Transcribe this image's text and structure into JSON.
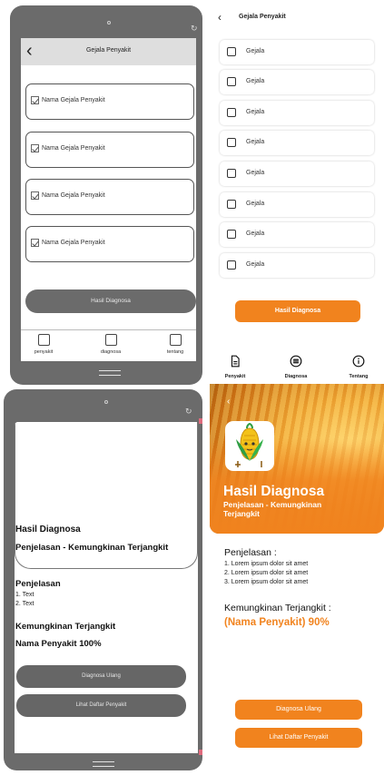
{
  "wireframe_selection": {
    "title": "Gejala Penyakit",
    "items": [
      "Nama Gejala Penyakit",
      "Nama Gejala Penyakit",
      "Nama Gejala Penyakit",
      "Nama Gejala Penyakit"
    ],
    "button_label": "Hasil Diagnosa",
    "nav": [
      "penyakit",
      "diagnosa",
      "tentang"
    ]
  },
  "wireframe_result": {
    "title": "Hasil Diagnosa",
    "subtitle": "Penjelasan - Kemungkinan Terjangkit",
    "explanation_title": "Penjelasan",
    "explanation_items": [
      "1. Text",
      "2. Text"
    ],
    "possibility_title": "Kemungkinan Terjangkit",
    "possibility_value": "Nama Penyakit 100%",
    "buttons": [
      "Diagnosa Ulang",
      "Lihat Daftar Penyakit"
    ]
  },
  "design_selection": {
    "title": "Gejala Penyakit",
    "items": [
      "Gejala",
      "Gejala",
      "Gejala",
      "Gejala",
      "Gejala",
      "Gejala",
      "Gejala",
      "Gejala"
    ],
    "button_label": "Hasil Diagnosa",
    "nav": [
      "Penyakit",
      "Diagnosa",
      "Tentang"
    ]
  },
  "design_result": {
    "title": "Hasil Diagnosa",
    "subtitle": "Penjelasan - Kemungkinan Terjangkit",
    "explanation_title": "Penjelasan :",
    "explanation_items": [
      "1. Lorem ipsum dolor sit amet",
      "2. Lorem ipsum dolor sit amet",
      "3. Lorem ipsum dolor sit amet"
    ],
    "possibility_title": "Kemungkinan Terjangkit :",
    "possibility_value": "(Nama Penyakit) 90%",
    "buttons": [
      "Diagnosa Ulang",
      "Lihat Daftar Penyakit"
    ]
  },
  "colors": {
    "accent": "#f1831e",
    "frame": "#6b6b6b"
  },
  "icons": [
    "chevron-left-icon",
    "rotate-icon",
    "document-icon",
    "list-icon",
    "info-icon",
    "corn-logo-icon"
  ]
}
